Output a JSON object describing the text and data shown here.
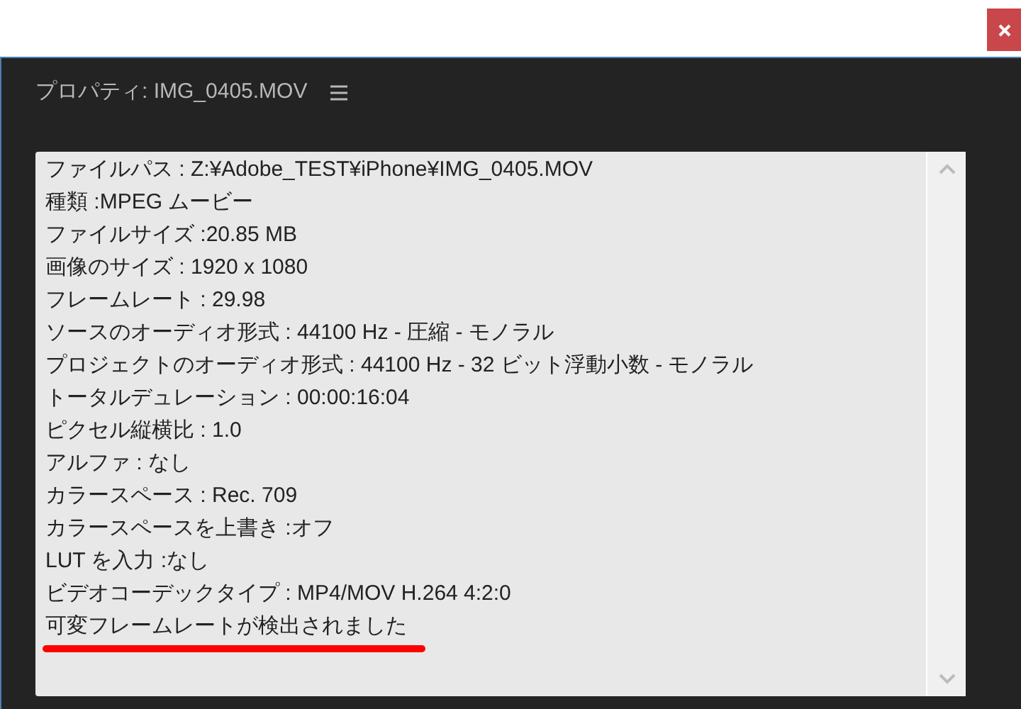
{
  "panel": {
    "title": "プロパティ: IMG_0405.MOV"
  },
  "properties": [
    "ファイルパス : Z:¥Adobe_TEST¥iPhone¥IMG_0405.MOV",
    "種類 :MPEG ムービー",
    "ファイルサイズ :20.85 MB",
    "画像のサイズ : 1920 x 1080",
    "フレームレート : 29.98",
    "ソースのオーディオ形式 : 44100 Hz - 圧縮 - モノラル",
    "プロジェクトのオーディオ形式 : 44100 Hz - 32 ビット浮動小数 - モノラル",
    "トータルデュレーション : 00:00:16:04",
    "ピクセル縦横比 : 1.0",
    "アルファ : なし",
    "カラースペース : Rec. 709",
    "カラースペースを上書き :オフ",
    "LUT を入力 :なし",
    "ビデオコーデックタイプ : MP4/MOV H.264 4:2:0",
    "可変フレームレートが検出されました"
  ]
}
